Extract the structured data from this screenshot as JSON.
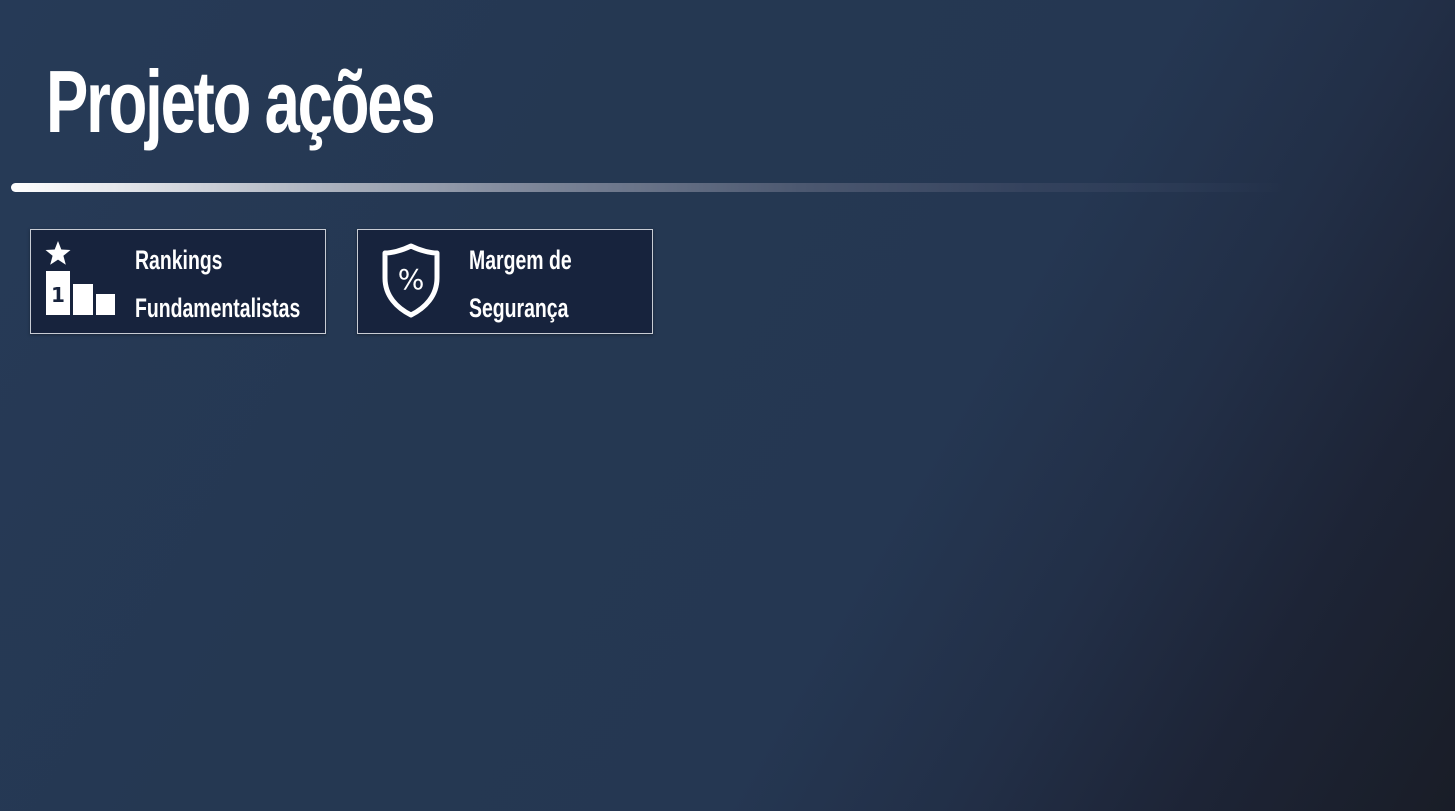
{
  "page": {
    "title": "Projeto ações"
  },
  "tiles": [
    {
      "icon": "podium-ranking-icon",
      "line1": "Rankings",
      "line2": "Fundamentalistas"
    },
    {
      "icon": "shield-percent-icon",
      "line1": "Margem de",
      "line2": "Segurança"
    }
  ],
  "colors": {
    "background_top_left": "#263a57",
    "background_bottom_right": "#191d27",
    "tile_background": "#17233d",
    "tile_border": "#c8ccd4",
    "text": "#ffffff"
  }
}
